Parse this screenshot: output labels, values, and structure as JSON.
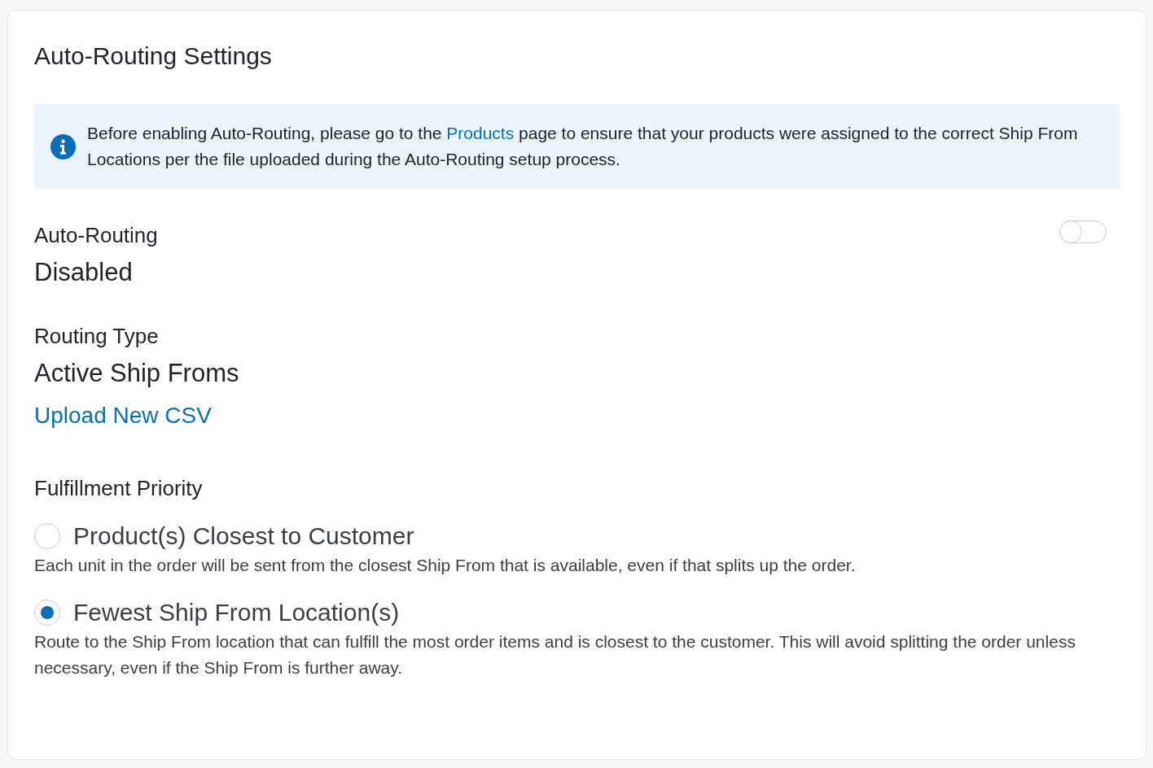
{
  "title": "Auto-Routing Settings",
  "notice": {
    "text_before": "Before enabling Auto-Routing, please go to the ",
    "link": "Products",
    "text_after": " page to ensure that your products were assigned to the correct Ship From Locations per the file uploaded during the Auto-Routing setup process."
  },
  "auto_routing": {
    "label": "Auto-Routing",
    "on": false,
    "status": "Disabled"
  },
  "routing_type": {
    "label": "Routing Type",
    "value": "Active Ship Froms"
  },
  "upload_link": "Upload New CSV",
  "fulfillment_priority": {
    "heading": "Fulfillment Priority",
    "options": [
      {
        "label": "Product(s) Closest to Customer",
        "description": "Each unit in the order will be sent from the closest Ship From that is available, even if that splits up the order.",
        "selected": false
      },
      {
        "label": "Fewest Ship From Location(s)",
        "description": "Route to the Ship From location that can fulfill the most order items and is closest to the customer. This will avoid splitting the order unless necessary, even if the Ship From is further away.",
        "selected": true
      }
    ]
  }
}
